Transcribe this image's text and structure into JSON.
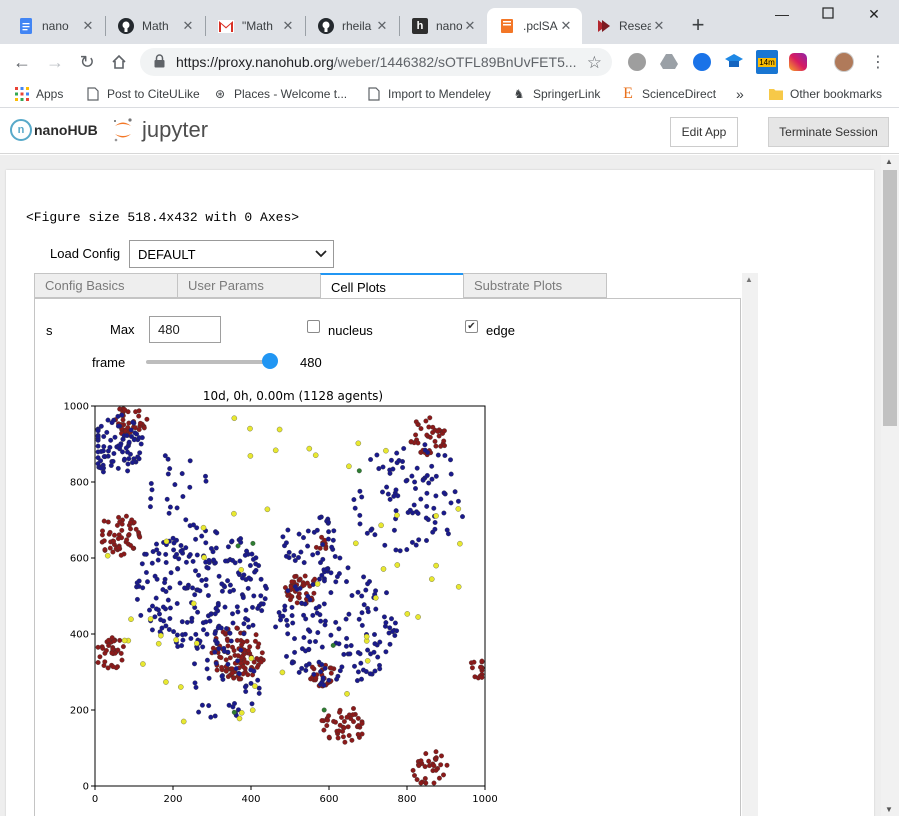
{
  "browser": {
    "tabs": [
      {
        "label": "nano",
        "icon": "docs-icon",
        "color": "#4285f4"
      },
      {
        "label": "Math",
        "icon": "github-icon",
        "color": "#24292e"
      },
      {
        "label": "\"Math",
        "icon": "gmail-icon",
        "color": "#d93025"
      },
      {
        "label": "rheila",
        "icon": "github-icon",
        "color": "#24292e"
      },
      {
        "label": "nano",
        "icon": "hub-icon",
        "color": "#333333"
      },
      {
        "label": ".pclSA",
        "icon": "notebook-icon",
        "color": "#f37626"
      },
      {
        "label": "Resea",
        "icon": "research-icon",
        "color": "#b3262e"
      }
    ],
    "active_tab_index": 5,
    "url_host": "https://proxy.nanohub.org",
    "url_path": "/weber/1446382/sOTFL89BnUvFET5...",
    "extension_badge": "14m"
  },
  "bookmarks": [
    {
      "label": "Apps",
      "icon": "apps-grid-icon"
    },
    {
      "label": "Post to CiteULike",
      "icon": "page-icon"
    },
    {
      "label": "Places - Welcome t...",
      "icon": "places-icon"
    },
    {
      "label": "Import to Mendeley",
      "icon": "page-icon"
    },
    {
      "label": "SpringerLink",
      "icon": "springer-icon"
    },
    {
      "label": "ScienceDirect",
      "icon": "sciencedirect-icon"
    }
  ],
  "bookmarks_overflow": "»",
  "other_bookmarks": "Other bookmarks",
  "app_header": {
    "nanohub_text": "nanoHUB",
    "jupyter_text": "jupyter",
    "edit_app": "Edit App",
    "terminate": "Terminate Session"
  },
  "notebook": {
    "figure_text": "<Figure size 518.4x432 with 0 Axes>",
    "load_config_label": "Load Config",
    "load_config_value": "DEFAULT",
    "tabs": [
      "Config Basics",
      "User Params",
      "Cell Plots",
      "Substrate Plots"
    ],
    "active_tab": 2,
    "controls": {
      "s_label": "s",
      "max_label": "Max",
      "max_value": "480",
      "nucleus_label": "nucleus",
      "nucleus_checked": false,
      "edge_label": "edge",
      "edge_checked": true,
      "frame_label": "frame",
      "frame_value": "480",
      "frame_fraction": 1.0
    }
  },
  "chart_data": {
    "type": "scatter",
    "title": "10d, 0h, 0.00m (1128 agents)",
    "xlabel": "",
    "ylabel": "",
    "xlim": [
      0,
      1000
    ],
    "ylim": [
      0,
      1000
    ],
    "xticks": [
      0,
      200,
      400,
      600,
      800,
      1000
    ],
    "yticks": [
      0,
      200,
      400,
      600,
      800,
      1000
    ],
    "grid": false,
    "series": [
      {
        "color": "#8b1a1a",
        "clusters": [
          {
            "cx": 90,
            "cy": 965,
            "r": 45,
            "n": 40
          },
          {
            "cx": 60,
            "cy": 660,
            "r": 55,
            "n": 55
          },
          {
            "cx": 40,
            "cy": 350,
            "r": 42,
            "n": 35
          },
          {
            "cx": 365,
            "cy": 350,
            "r": 70,
            "n": 100
          },
          {
            "cx": 530,
            "cy": 520,
            "r": 45,
            "n": 40
          },
          {
            "cx": 580,
            "cy": 640,
            "r": 20,
            "n": 8
          },
          {
            "cx": 585,
            "cy": 300,
            "r": 38,
            "n": 25
          },
          {
            "cx": 635,
            "cy": 160,
            "r": 55,
            "n": 45
          },
          {
            "cx": 855,
            "cy": 920,
            "r": 50,
            "n": 38
          },
          {
            "cx": 855,
            "cy": 45,
            "r": 50,
            "n": 32
          },
          {
            "cx": 985,
            "cy": 310,
            "r": 28,
            "n": 16
          }
        ]
      },
      {
        "color": "#1a1a8c",
        "clusters": [
          {
            "cx": 50,
            "cy": 900,
            "r": 80,
            "n": 85
          },
          {
            "cx": 270,
            "cy": 520,
            "r": 170,
            "n": 230
          },
          {
            "cx": 330,
            "cy": 270,
            "r": 100,
            "n": 40
          },
          {
            "cx": 620,
            "cy": 420,
            "r": 160,
            "n": 150
          },
          {
            "cx": 810,
            "cy": 760,
            "r": 150,
            "n": 90
          },
          {
            "cx": 560,
            "cy": 640,
            "r": 80,
            "n": 40
          },
          {
            "cx": 200,
            "cy": 790,
            "r": 100,
            "n": 20
          }
        ]
      },
      {
        "color": "#e8e830",
        "clusters": [
          {
            "cx": 500,
            "cy": 500,
            "r": 490,
            "n": 55
          }
        ]
      },
      {
        "color": "#2e7d32",
        "clusters": [
          {
            "cx": 500,
            "cy": 500,
            "r": 400,
            "n": 6
          }
        ]
      }
    ],
    "point_seed": 7
  }
}
